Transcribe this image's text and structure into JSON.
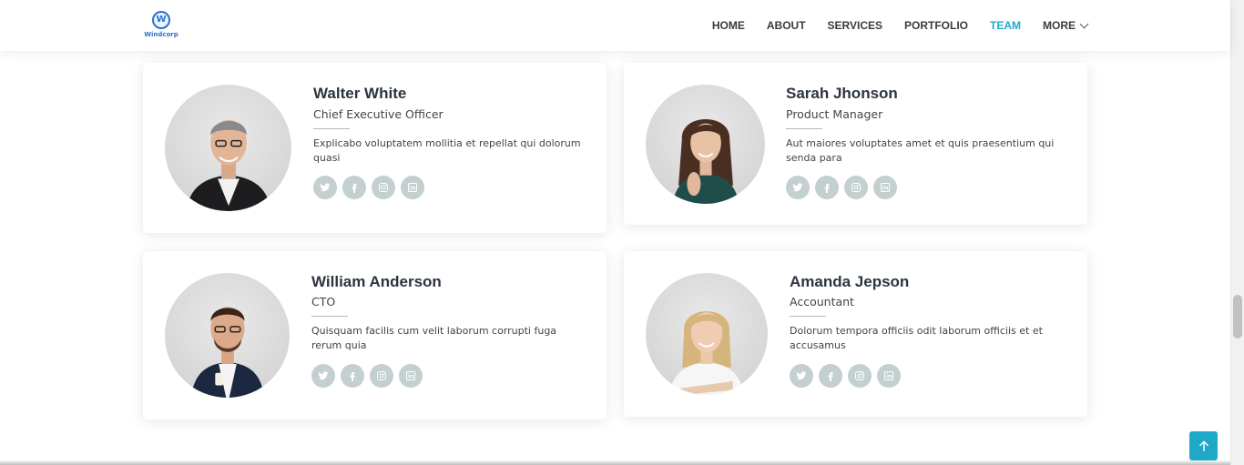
{
  "header": {
    "logo_text": "Windcorp",
    "logo_letter": "W",
    "nav": [
      {
        "label": "HOME"
      },
      {
        "label": "ABOUT"
      },
      {
        "label": "SERVICES"
      },
      {
        "label": "PORTFOLIO"
      },
      {
        "label": "TEAM",
        "active": true
      },
      {
        "label": "MORE",
        "dropdown": true
      }
    ]
  },
  "team": [
    {
      "name": "Walter White",
      "role": "Chief Executive Officer",
      "desc": "Explicabo voluptatem mollitia et repellat qui dolorum quasi",
      "socials": [
        "twitter-icon",
        "facebook-icon",
        "instagram-icon",
        "linkedin-icon"
      ]
    },
    {
      "name": "Sarah Jhonson",
      "role": "Product Manager",
      "desc": "Aut maiores voluptates amet et quis praesentium qui senda para",
      "socials": [
        "twitter-icon",
        "facebook-icon",
        "instagram-icon",
        "linkedin-icon"
      ]
    },
    {
      "name": "William Anderson",
      "role": "CTO",
      "desc": "Quisquam facilis cum velit laborum corrupti fuga rerum quia",
      "socials": [
        "twitter-icon",
        "facebook-icon",
        "instagram-icon",
        "linkedin-icon"
      ]
    },
    {
      "name": "Amanda Jepson",
      "role": "Accountant",
      "desc": "Dolorum tempora officiis odit laborum officiis et et accusamus",
      "socials": [
        "twitter-icon",
        "facebook-icon",
        "instagram-icon",
        "linkedin-icon"
      ]
    }
  ],
  "colors": {
    "accent": "#1fa9c9",
    "social_bg": "#c4cfd0",
    "title": "#2c3441"
  },
  "back_to_top": {
    "icon": "arrow-up-icon"
  }
}
